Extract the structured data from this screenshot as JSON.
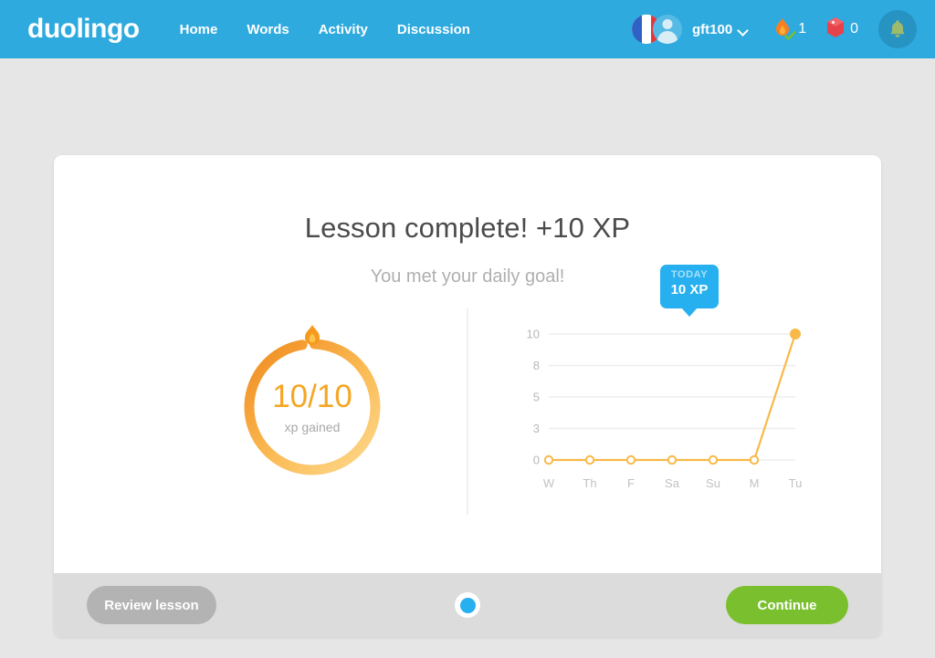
{
  "header": {
    "brand": "duolingo",
    "nav": [
      {
        "label": "Home"
      },
      {
        "label": "Words"
      },
      {
        "label": "Activity"
      },
      {
        "label": "Discussion"
      }
    ],
    "flag_icon": "france-flag-icon",
    "avatar_icon": "user-avatar-icon",
    "username": "gft100",
    "chevron_icon": "chevron-down-icon",
    "streak": {
      "icon": "flame-streak-icon",
      "value": "1"
    },
    "gems": {
      "icon": "ruby-gem-icon",
      "value": "0"
    },
    "bell_icon": "bell-notification-icon",
    "bar_color": "#2eaade"
  },
  "lesson": {
    "title": "Lesson complete! +10 XP",
    "subtitle": "You met your daily goal!",
    "ring": {
      "value": "10/10",
      "caption": "xp gained",
      "flame_icon": "flame-icon",
      "progress_pct": 100,
      "color_start": "#fbd07a",
      "color_end": "#f08a1e"
    }
  },
  "chart_data": {
    "type": "line",
    "title": "",
    "xlabel": "",
    "ylabel": "",
    "categories": [
      "W",
      "Th",
      "F",
      "Sa",
      "Su",
      "M",
      "Tu"
    ],
    "values": [
      0,
      0,
      0,
      0,
      0,
      0,
      10
    ],
    "ytick_labels": [
      "10",
      "8",
      "5",
      "3",
      "0"
    ],
    "ytick_values": [
      10,
      8,
      5,
      3,
      0
    ],
    "ylim": [
      0,
      10
    ],
    "grid": true,
    "legend": "none",
    "line_color": "#f9b949",
    "marker_filled_index": 6,
    "annotation": {
      "label": "TODAY",
      "value": "10 XP",
      "at_category": "Tu",
      "color": "#27b0ef"
    }
  },
  "footer": {
    "review_label": "Review lesson",
    "continue_label": "Continue",
    "step_indicator": "step-dot-active",
    "continue_color": "#7ac02e",
    "review_color": "#b3b3b3"
  }
}
